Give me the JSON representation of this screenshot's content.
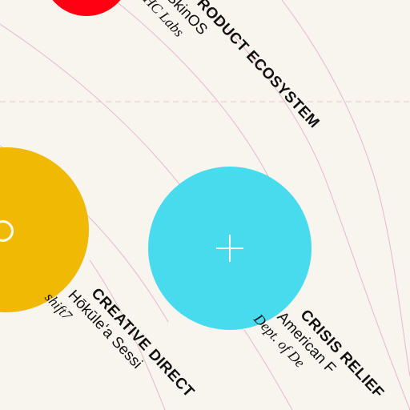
{
  "items": [
    {
      "category": "PRODUCT ECOSYSTEM",
      "title": "SkinOS",
      "org": "HC Labs",
      "color": "#ff0013"
    },
    {
      "category": "CREATIVE DIRECT",
      "title": "Hōkūleʻa Sessi",
      "org": "shift7",
      "color": "#efb904"
    },
    {
      "category": "CRISIS RELIEF",
      "title": "American F",
      "org": "Dept. of De",
      "color": "#48dbee"
    }
  ],
  "icons": {
    "blue_circle_icon": "plus-icon",
    "yellow_circle_icon": "ring-icon"
  },
  "colors": {
    "background": "#f8f5ef",
    "guide_lines": "#e8b9c3"
  }
}
